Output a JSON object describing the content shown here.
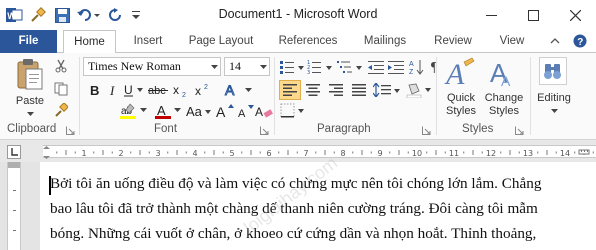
{
  "app": {
    "title": "Document1  -  Microsoft Word"
  },
  "tabs": [
    "File",
    "Home",
    "Insert",
    "Page Layout",
    "References",
    "Mailings",
    "Review",
    "View"
  ],
  "ribbon": {
    "clipboard": {
      "paste_label": "Paste",
      "group_label": "Clipboard"
    },
    "font": {
      "font_name": "Times New Roman",
      "font_size": "14",
      "group_label": "Font"
    },
    "paragraph": {
      "group_label": "Paragraph"
    },
    "styles": {
      "quick_styles_label": "Quick Styles",
      "change_styles_label": "Change Styles",
      "group_label": "Styles"
    },
    "editing": {
      "label": "Editing"
    }
  },
  "document": {
    "lines": [
      "Bởi tôi ăn uống điều độ và làm việc có chừng mực nên tôi chóng lớn lắm. Chẳng",
      "bao lâu tôi đã trở thành một chàng dế thanh niên cường tráng. Đôi càng tôi mẫm",
      "bóng. Những cái vuốt ở chân, ở khoeo cứ cứng dần và nhọn hoắt. Thỉnh thoảng,"
    ]
  },
  "watermark": "loigiaihay.com",
  "colors": {
    "accent": "#2b579a",
    "highlight": "#ffff00",
    "font_color": "#c00000",
    "active_button": "#fcd98c"
  }
}
